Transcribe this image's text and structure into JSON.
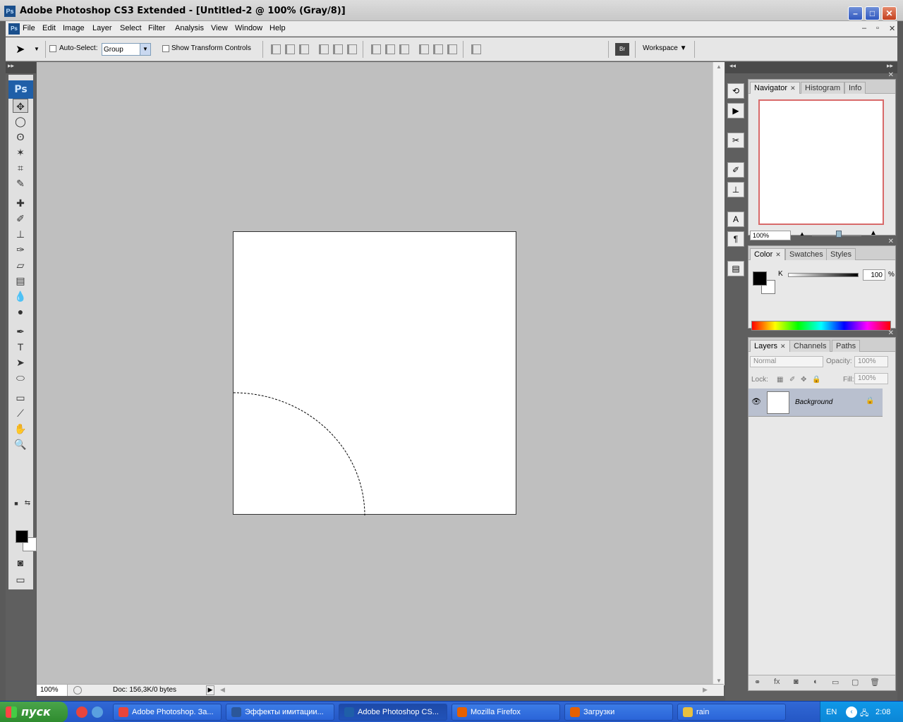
{
  "window": {
    "title": "Adobe Photoshop CS3 Extended - [Untitled-2 @ 100% (Gray/8)]",
    "logo_text": "Ps",
    "min_icon": "minimize-icon",
    "max_icon": "maximize-icon",
    "close_icon": "close-icon"
  },
  "menu": {
    "items": [
      "File",
      "Edit",
      "Image",
      "Layer",
      "Select",
      "Filter",
      "Analysis",
      "View",
      "Window",
      "Help"
    ],
    "doc_controls": [
      "–",
      "▫",
      "✕"
    ]
  },
  "options": {
    "auto_select_label": "Auto-Select:",
    "auto_select_value": "Group",
    "show_transform_label": "Show Transform Controls",
    "workspace_label": "Workspace ▼",
    "bridge_icon": "bridge-icon"
  },
  "tools": {
    "logo": "Ps",
    "items": [
      {
        "name": "move-tool-icon",
        "glyph": "✥"
      },
      {
        "name": "marquee-tool-icon",
        "glyph": "◯"
      },
      {
        "name": "lasso-tool-icon",
        "glyph": "ʘ"
      },
      {
        "name": "magic-wand-tool-icon",
        "glyph": "✶"
      },
      {
        "name": "crop-tool-icon",
        "glyph": "⌗"
      },
      {
        "name": "slice-tool-icon",
        "glyph": "✎"
      },
      {
        "name": "healing-brush-tool-icon",
        "glyph": "✚"
      },
      {
        "name": "brush-tool-icon",
        "glyph": "✐"
      },
      {
        "name": "clone-stamp-tool-icon",
        "glyph": "⊥"
      },
      {
        "name": "history-brush-tool-icon",
        "glyph": "✑"
      },
      {
        "name": "eraser-tool-icon",
        "glyph": "▱"
      },
      {
        "name": "gradient-tool-icon",
        "glyph": "▤"
      },
      {
        "name": "blur-tool-icon",
        "glyph": "💧"
      },
      {
        "name": "dodge-tool-icon",
        "glyph": "●"
      },
      {
        "name": "pen-tool-icon",
        "glyph": "✒"
      },
      {
        "name": "type-tool-icon",
        "glyph": "T"
      },
      {
        "name": "path-selection-tool-icon",
        "glyph": "➤"
      },
      {
        "name": "ellipse-tool-icon",
        "glyph": "⬭"
      },
      {
        "name": "notes-tool-icon",
        "glyph": "▭"
      },
      {
        "name": "eyedropper-tool-icon",
        "glyph": "⟋"
      },
      {
        "name": "hand-tool-icon",
        "glyph": "✋"
      },
      {
        "name": "zoom-tool-icon",
        "glyph": "🔍"
      }
    ]
  },
  "status": {
    "zoom": "100%",
    "doc": "Doc: 156,3K/0 bytes"
  },
  "navigator": {
    "tabs": [
      "Navigator",
      "Histogram",
      "Info"
    ],
    "zoom": "100%"
  },
  "color": {
    "tabs": [
      "Color",
      "Swatches",
      "Styles"
    ],
    "channel": "K",
    "value": "100",
    "unit": "%"
  },
  "layers": {
    "tabs": [
      "Layers",
      "Channels",
      "Paths"
    ],
    "blend": "Normal",
    "opacity_label": "Opacity:",
    "opacity_value": "100%",
    "lock_label": "Lock:",
    "fill_label": "Fill:",
    "fill_value": "100%",
    "layer_name": "Background"
  },
  "taskbar": {
    "start": "пуск",
    "buttons": [
      {
        "label": "Adobe Photoshop. За...",
        "icon": "chrome-icon",
        "color": "#e8453c"
      },
      {
        "label": "Эффекты имитации...",
        "icon": "word-icon",
        "color": "#2b579a"
      },
      {
        "label": "Adobe Photoshop CS...",
        "icon": "photoshop-icon",
        "color": "#1f5fa8"
      },
      {
        "label": "Mozilla Firefox",
        "icon": "firefox-icon",
        "color": "#e66000"
      },
      {
        "label": "Загрузки",
        "icon": "firefox-icon",
        "color": "#e66000"
      },
      {
        "label": "rain",
        "icon": "folder-icon",
        "color": "#e8c040"
      }
    ],
    "lang": "EN",
    "time": "2:08"
  }
}
